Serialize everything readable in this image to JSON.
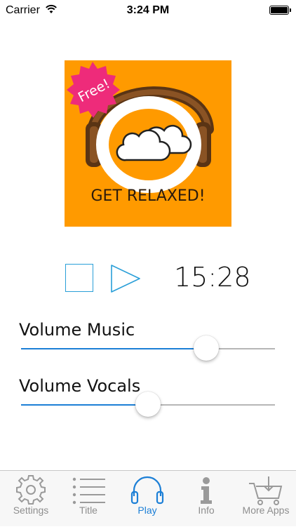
{
  "status_bar": {
    "carrier": "Carrier",
    "time": "3:24 PM"
  },
  "album_art": {
    "badge_text": "Free!",
    "title_text": "GET RELAXED!",
    "background_color": "#ff9a00",
    "badge_color": "#ee2b7a"
  },
  "player": {
    "time": "15:28",
    "accent_color": "#2a9fd8"
  },
  "sliders": [
    {
      "label": "Volume Music",
      "value": 0.73
    },
    {
      "label": "Volume Vocals",
      "value": 0.5
    }
  ],
  "tabs": [
    {
      "label": "Settings",
      "icon": "gear-icon"
    },
    {
      "label": "Title",
      "icon": "list-icon"
    },
    {
      "label": "Play",
      "icon": "headphones-icon",
      "active": true
    },
    {
      "label": "Info",
      "icon": "info-icon"
    },
    {
      "label": "More Apps",
      "icon": "cart-icon"
    }
  ]
}
